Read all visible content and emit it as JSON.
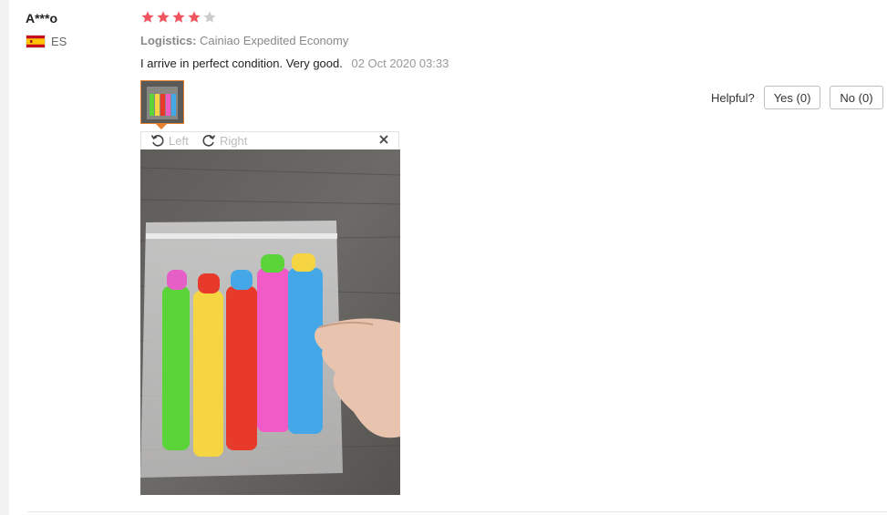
{
  "review": {
    "user_name": "A***o",
    "country_code": "ES",
    "rating": 4,
    "max_rating": 5,
    "logistics_label": "Logistics:",
    "logistics_value": "Cainiao Expedited Economy",
    "text": "I arrive in perfect condition. Very good.",
    "date": "02 Oct 2020 03:33"
  },
  "viewer": {
    "rotate_left_label": "Left",
    "rotate_right_label": "Right"
  },
  "helpful": {
    "label": "Helpful?",
    "yes_label": "Yes (0)",
    "no_label": "No (0)"
  },
  "colors": {
    "star_filled": "#f0555f",
    "star_empty": "#cccccc",
    "thumb_border": "#e8812f"
  },
  "icons": {
    "flag": "spain-flag-icon",
    "star": "star-icon",
    "rotate_left": "rotate-left-icon",
    "rotate_right": "rotate-right-icon",
    "close": "close-icon"
  }
}
